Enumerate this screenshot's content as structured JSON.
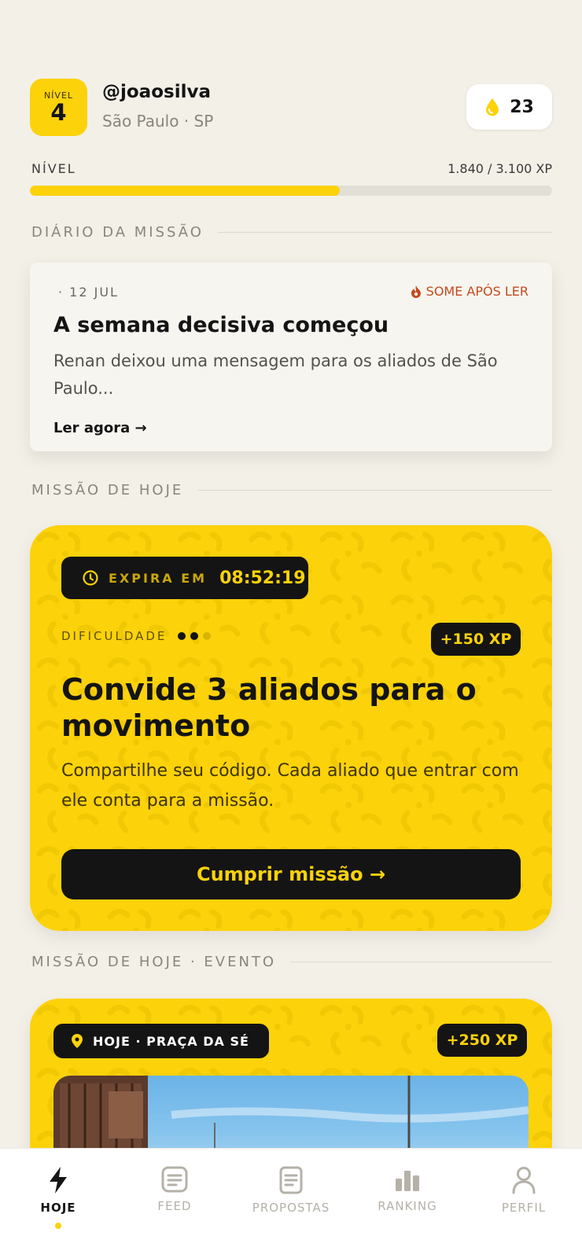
{
  "header": {
    "level_label": "NÍVEL",
    "level_number": "4",
    "username": "@joaosilva",
    "location": "São Paulo · SP",
    "coins": "23",
    "coin_icon": "drop-icon"
  },
  "progress": {
    "title": "NÍVEL",
    "xp_text": "1.840 / 3.100 XP",
    "fraction": 0.594
  },
  "diary": {
    "section_title": "DIÁRIO DA MISSÃO",
    "date": "· 12 JUL",
    "tag": "SOME APÓS LER",
    "title": "A semana decisiva começou",
    "body": "Renan deixou uma mensagem para os aliados de São Paulo...",
    "cta": "Ler agora →"
  },
  "mission": {
    "section_title": "MISSÃO DE HOJE",
    "expires_label": "EXPIRA EM",
    "expires_time": "08:52:19",
    "difficulty_label": "DIFICULDADE",
    "difficulty_level": 2,
    "difficulty_max": 3,
    "xp": "+150 XP",
    "title": "Convide 3 aliados para o movimento",
    "description": "Compartilhe seu código. Cada aliado que entrar com ele conta para a missão.",
    "cta": "Cumprir missão →"
  },
  "event": {
    "section_title": "MISSÃO DE HOJE · EVENTO",
    "location_label": "HOJE · PRAÇA DA SÉ",
    "xp": "+250 XP"
  },
  "nav": {
    "items": [
      {
        "label": "HOJE",
        "icon": "lightning-icon",
        "active": true
      },
      {
        "label": "FEED",
        "icon": "feed-icon",
        "active": false
      },
      {
        "label": "PROPOSTAS",
        "icon": "document-icon",
        "active": false
      },
      {
        "label": "RANKING",
        "icon": "bar-chart-icon",
        "active": false
      },
      {
        "label": "PERFIL",
        "icon": "person-icon",
        "active": false
      }
    ]
  },
  "colors": {
    "accent": "#fcd20a",
    "dark": "#141414",
    "background": "#f3f0e8",
    "alert": "#c24a1c"
  }
}
